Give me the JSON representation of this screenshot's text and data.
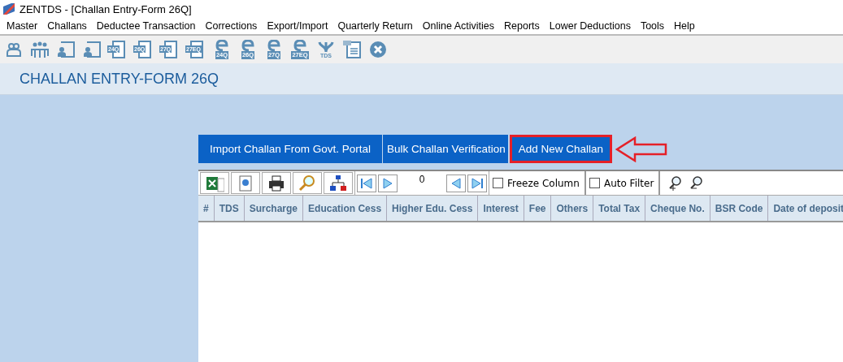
{
  "window": {
    "title": "ZENTDS - [Challan Entry-Form 26Q]"
  },
  "menu": [
    "Master",
    "Challans",
    "Deductee Transaction",
    "Corrections",
    "Export/Import",
    "Quarterly Return",
    "Online Activities",
    "Reports",
    "Lower Deductions",
    "Tools",
    "Help"
  ],
  "toolbar": [
    {
      "kind": "person"
    },
    {
      "kind": "group"
    },
    {
      "kind": "form"
    },
    {
      "kind": "form"
    },
    {
      "kind": "return",
      "label": "24Q"
    },
    {
      "kind": "return",
      "label": "26Q"
    },
    {
      "kind": "return",
      "label": "27Q"
    },
    {
      "kind": "return",
      "label": "27EQ"
    },
    {
      "kind": "efile",
      "label": "24Q"
    },
    {
      "kind": "efile",
      "label": "26Q"
    },
    {
      "kind": "efile",
      "label": "27Q"
    },
    {
      "kind": "efile",
      "label": "27EQ"
    },
    {
      "kind": "tds",
      "label": "TDS"
    },
    {
      "kind": "pdf"
    },
    {
      "kind": "close"
    }
  ],
  "page_title": "CHALLAN ENTRY-FORM 26Q",
  "actions": [
    {
      "label": "Import Challan From Govt. Portal",
      "highlighted": false
    },
    {
      "label": "Bulk Challan Verification",
      "highlighted": false
    },
    {
      "label": "Add New Challan",
      "highlighted": true
    }
  ],
  "grid": {
    "page": "0",
    "freeze_column": {
      "label": "Freeze Column",
      "checked": false
    },
    "auto_filter": {
      "label": "Auto Filter",
      "checked": false
    },
    "columns": [
      "#",
      "TDS",
      "Surcharge",
      "Education Cess",
      "Higher Edu. Cess",
      "Interest",
      "Fee",
      "Others",
      "Total Tax",
      "Cheque No.",
      "BSR Code",
      "Date of deposit"
    ]
  }
}
